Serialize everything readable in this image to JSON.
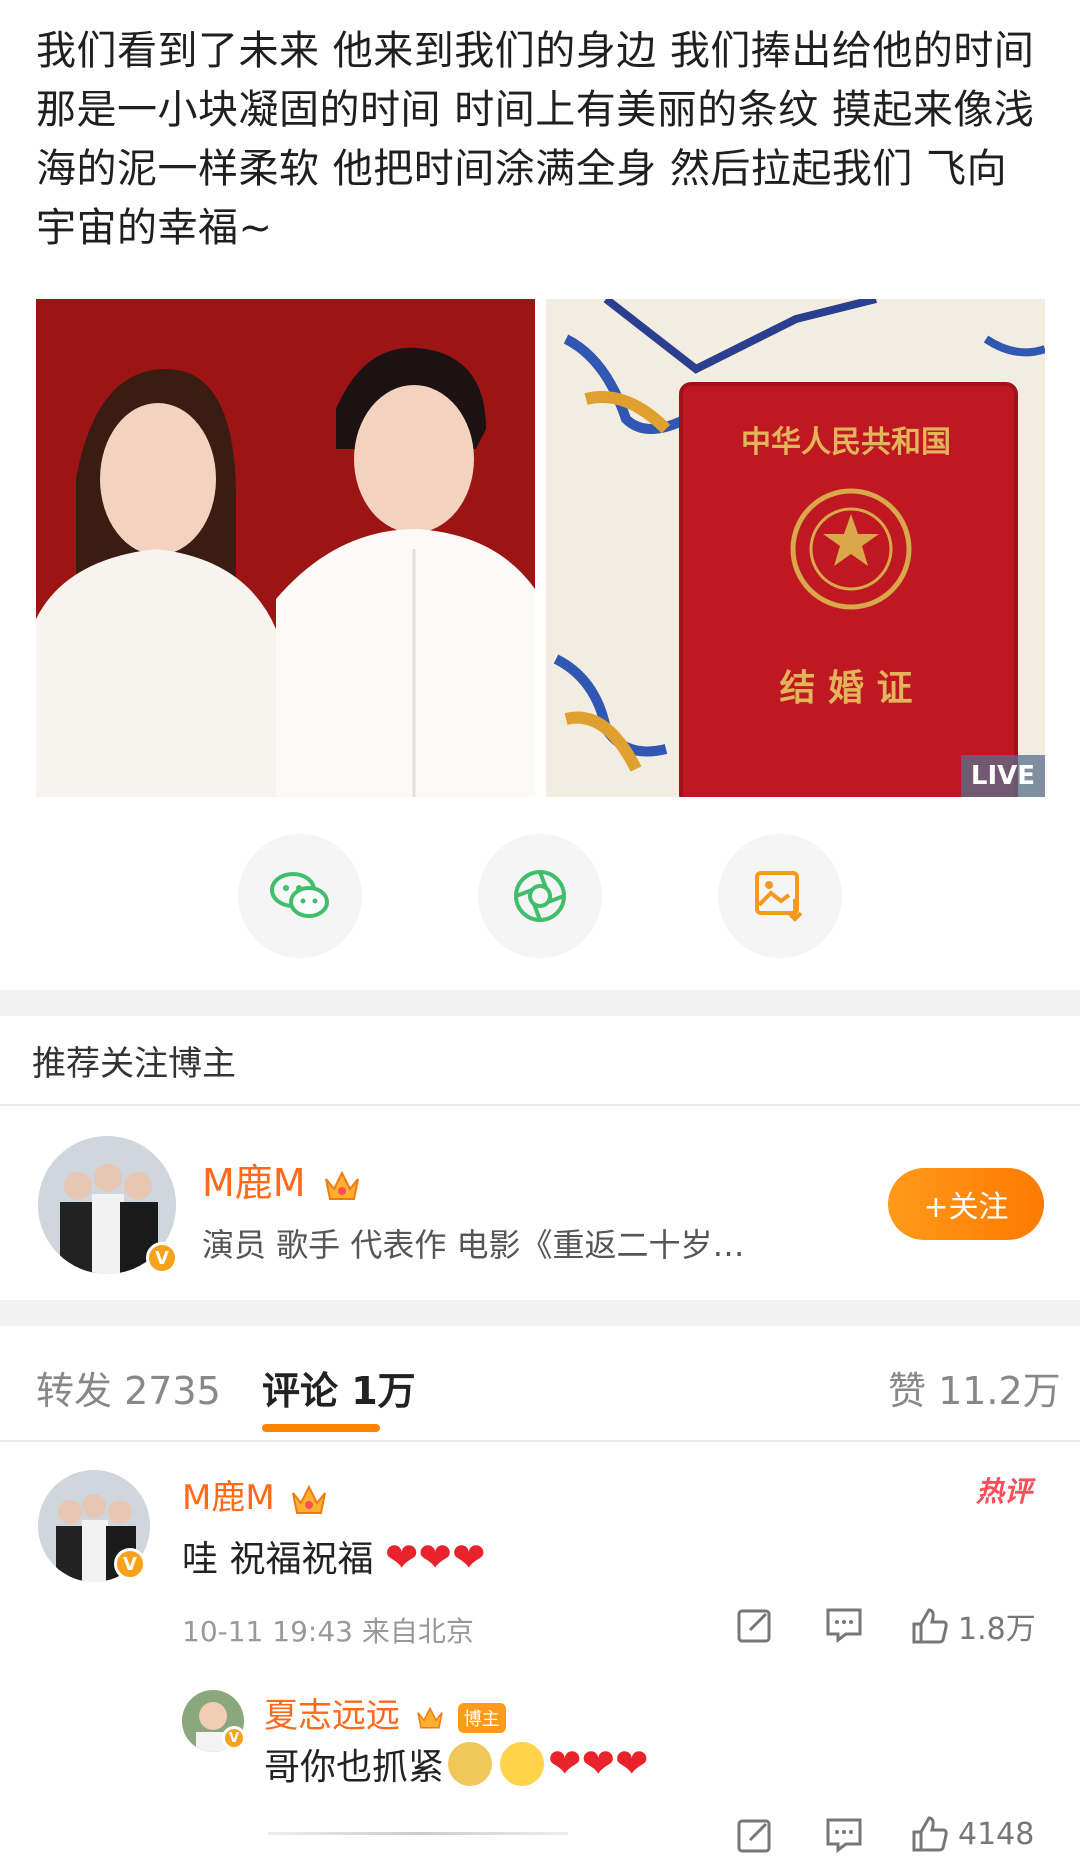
{
  "post": {
    "text": "我们看到了未来 他来到我们的身边 我们捧出给他的时间 那是一小块凝固的时间 时间上有美丽的条纹 摸起来像浅海的泥一样柔软 他把时间涂满全身 然后拉起我们 飞向宇宙的幸福~",
    "photo_right_title": "中华人民共和国",
    "photo_right_bottom": "结 婚 证",
    "live_badge": "LIVE"
  },
  "share": {
    "icons": [
      "wechat-icon",
      "moments-icon",
      "save-image-icon"
    ],
    "colors": {
      "wechat": "#3fbf6b",
      "moments": "#3fbf6b",
      "save": "#f39a1e"
    }
  },
  "recommend": {
    "header": "推荐关注博主",
    "name": "M鹿M",
    "desc": "演员 歌手 代表作 电影《重返二十岁…",
    "follow_label": "+关注"
  },
  "tabs": {
    "repost": "转发 2735",
    "comment": "评论 1万",
    "like": "赞 11.2万"
  },
  "comment": {
    "name": "M鹿M",
    "hot_label": "热评",
    "text": "哇 祝福祝福",
    "hearts": "❤❤❤",
    "meta": "10-11 19:43 来自北京",
    "like_count": "1.8万"
  },
  "reply": {
    "name": "夏志远远",
    "blogger_tag": "博主",
    "text": "哥你也抓紧",
    "hearts": "❤❤❤",
    "like_count": "4148"
  },
  "colors": {
    "accent": "#ff8200",
    "name_orange": "#ff6a1a",
    "heart": "#e8232b"
  }
}
